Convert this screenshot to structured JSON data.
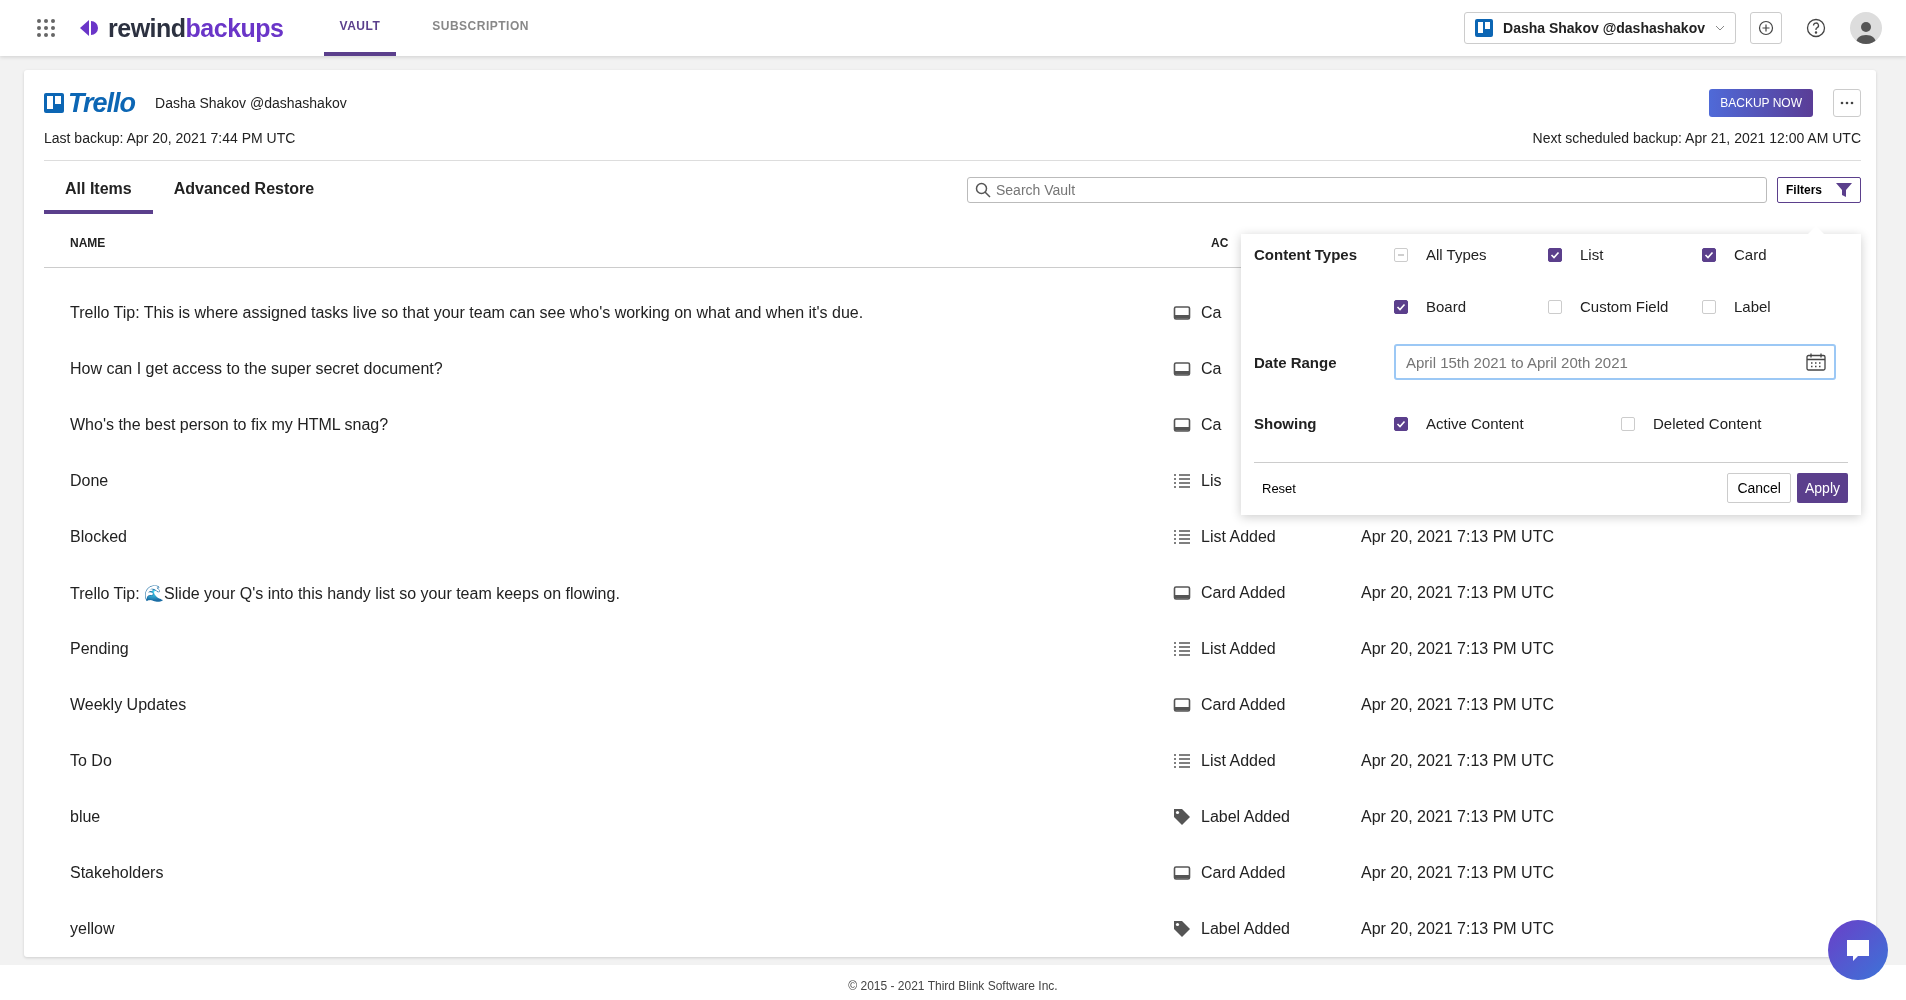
{
  "topbar": {
    "logo": {
      "first": "rewind",
      "second": "backups"
    },
    "tabs": [
      {
        "label": "VAULT",
        "selected": true
      },
      {
        "label": "SUBSCRIPTION",
        "selected": false
      }
    ],
    "account": "Dasha Shakov @dashashakov"
  },
  "header": {
    "service_logo": "Trello",
    "account": "Dasha Shakov @dashashakov",
    "backup_button": "BACKUP NOW",
    "last_backup": "Last backup: Apr 20, 2021 7:44 PM UTC",
    "next_backup": "Next scheduled backup: Apr 21, 2021 12:00 AM UTC"
  },
  "tabs": [
    {
      "label": "All Items",
      "selected": true
    },
    {
      "label": "Advanced Restore",
      "selected": false
    }
  ],
  "search": {
    "placeholder": "Search Vault"
  },
  "filters_button": "Filters",
  "table": {
    "columns": [
      "NAME",
      "AC"
    ],
    "rows": [
      {
        "name": "Trello Tip: This is where assigned tasks live so that your team can see who's working on what and when it's due.",
        "kind": "card",
        "activity": "Ca"
      },
      {
        "name": "How can I get access to the super secret document?",
        "kind": "card",
        "activity": "Ca"
      },
      {
        "name": "Who's the best person to fix my HTML snag?",
        "kind": "card",
        "activity": "Ca"
      },
      {
        "name": "Done",
        "kind": "list",
        "activity": "Lis"
      },
      {
        "name": "Blocked",
        "kind": "list",
        "activity": "List Added",
        "time": "Apr 20, 2021 7:13 PM UTC"
      },
      {
        "name": "Trello Tip: 🌊Slide your Q's into this handy list so your team keeps on flowing.",
        "kind": "card",
        "activity": "Card Added",
        "time": "Apr 20, 2021 7:13 PM UTC"
      },
      {
        "name": "Pending",
        "kind": "list",
        "activity": "List Added",
        "time": "Apr 20, 2021 7:13 PM UTC"
      },
      {
        "name": "Weekly Updates",
        "kind": "card",
        "activity": "Card Added",
        "time": "Apr 20, 2021 7:13 PM UTC"
      },
      {
        "name": "To Do",
        "kind": "list",
        "activity": "List Added",
        "time": "Apr 20, 2021 7:13 PM UTC"
      },
      {
        "name": "blue",
        "kind": "label",
        "activity": "Label Added",
        "time": "Apr 20, 2021 7:13 PM UTC"
      },
      {
        "name": "Stakeholders",
        "kind": "card",
        "activity": "Card Added",
        "time": "Apr 20, 2021 7:13 PM UTC"
      },
      {
        "name": "yellow",
        "kind": "label",
        "activity": "Label Added",
        "time": "Apr 20, 2021 7:13 PM UTC"
      }
    ]
  },
  "filter_panel": {
    "content_types_label": "Content Types",
    "content_types": [
      {
        "label": "All Types",
        "checked": false,
        "indeterminate": true
      },
      {
        "label": "List",
        "checked": true
      },
      {
        "label": "Card",
        "checked": true
      },
      {
        "label": "Board",
        "checked": true
      },
      {
        "label": "Custom Field",
        "checked": false
      },
      {
        "label": "Label",
        "checked": false
      }
    ],
    "date_range_label": "Date Range",
    "date_range": {
      "placeholder": "April 15th 2021 to April 20th 2021"
    },
    "showing_label": "Showing",
    "showing": [
      {
        "label": "Active Content",
        "checked": true
      },
      {
        "label": "Deleted Content",
        "checked": false
      }
    ],
    "reset": "Reset",
    "cancel": "Cancel",
    "apply": "Apply"
  },
  "footer": "© 2015 - 2021 Third Blink Software Inc."
}
